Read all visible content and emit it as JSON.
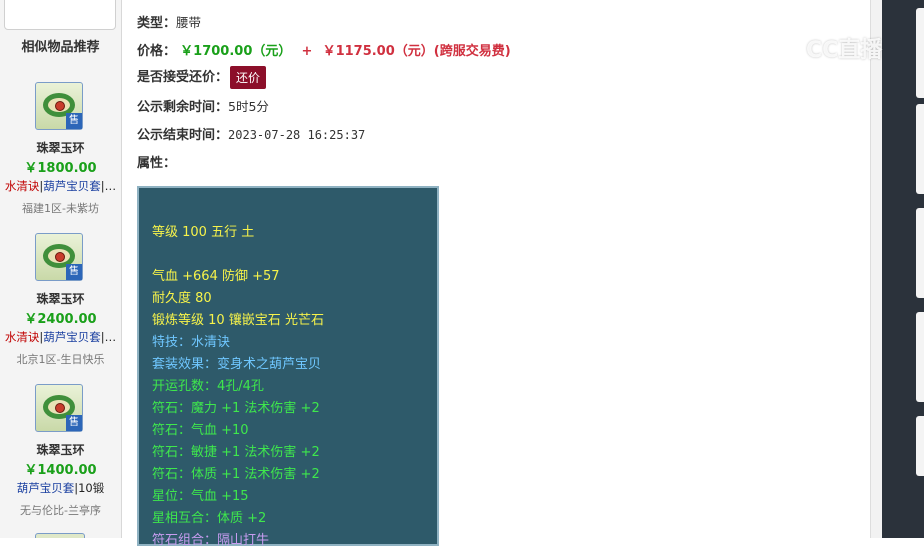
{
  "sidebar": {
    "title": "相似物品推荐",
    "items": [
      {
        "name": "珠翠玉环",
        "price": "￥1800.00",
        "tag_red": "水清诀",
        "tag_blue": "葫芦宝贝套",
        "tag_more": "|…",
        "server": "福建1区-未紫坊",
        "sell": "售"
      },
      {
        "name": "珠翠玉环",
        "price": "￥2400.00",
        "tag_red": "水清诀",
        "tag_blue": "葫芦宝贝套",
        "tag_more": "|…",
        "server": "北京1区-生日快乐",
        "sell": "售"
      },
      {
        "name": "珠翠玉环",
        "price": "￥1400.00",
        "tag_red": "",
        "tag_blue": "葫芦宝贝套",
        "tag_more": "|10锻",
        "server": "无与伦比-兰亭序",
        "sell": "售"
      }
    ]
  },
  "detail": {
    "type_label": "类型：",
    "type_value": "腰带",
    "price_label": "价格：",
    "price_main": "￥1700.00（元）",
    "price_plus": "+",
    "price_extra": "￥1175.00（元）(跨服交易费)",
    "bargain_label": "是否接受还价：",
    "bargain_button": "还价",
    "remaining_label": "公示剩余时间：",
    "remaining_value": "5时5分",
    "end_label": "公示结束时间：",
    "end_value": "2023-07-28 16:25:37",
    "attr_label": "属性："
  },
  "attributes": [
    {
      "text": "等级 100 五行 土",
      "color": "yellow"
    },
    {
      "text": "气血 +664 防御 +57",
      "color": "yellow"
    },
    {
      "text": "耐久度 80",
      "color": "yellow"
    },
    {
      "text": "锻炼等级 10 镶嵌宝石 光芒石",
      "color": "yellow"
    },
    {
      "text": "特技：水清诀",
      "color": "blue"
    },
    {
      "text": "套装效果：变身术之葫芦宝贝",
      "color": "blue"
    },
    {
      "text": "开运孔数：4孔/4孔",
      "color": "green"
    },
    {
      "text": "符石：魔力 +1 法术伤害 +2",
      "color": "green"
    },
    {
      "text": "符石：气血 +10",
      "color": "green"
    },
    {
      "text": "符石：敏捷 +1 法术伤害 +2",
      "color": "green"
    },
    {
      "text": "符石：体质 +1 法术伤害 +2",
      "color": "green"
    },
    {
      "text": "星位：气血 +15",
      "color": "green"
    },
    {
      "text": "星相互合：体质 +2",
      "color": "green"
    },
    {
      "text": "符石组合：隔山打牛",
      "color": "purple"
    }
  ],
  "watermark": "CC直播",
  "colors": {
    "price_green": "#1aa01a",
    "price_red": "#d0303f",
    "bargain_bg": "#8c0f2a",
    "attr_bg": "#2e5a6a",
    "attr_yellow": "#f7f34a",
    "attr_blue": "#6fc7ff",
    "attr_green": "#3ee84c",
    "attr_purple": "#c79cf0"
  }
}
